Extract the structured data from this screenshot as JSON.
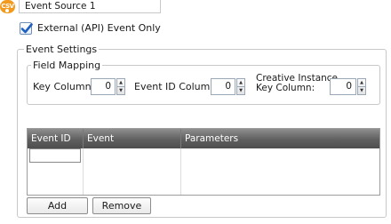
{
  "source": {
    "icon_text": "CSV",
    "name": "Event Source 1"
  },
  "external_only": {
    "label": "External (API) Event Only",
    "checked": true
  },
  "event_settings": {
    "legend": "Event Settings",
    "field_mapping": {
      "legend": "Field Mapping",
      "key_column": {
        "label": "Key Column:",
        "value": "0"
      },
      "event_id_column": {
        "label": "Event ID Column:",
        "value": "0"
      },
      "creative_instance_key_column": {
        "label_line1": "Creative Instance",
        "label_line2": "Key Column:",
        "value": "0"
      }
    },
    "grid": {
      "columns": [
        "Event ID",
        "Event",
        "Parameters"
      ]
    },
    "buttons": {
      "add": "Add",
      "remove": "Remove"
    }
  },
  "colors": {
    "accent": "#f29a1d",
    "check": "#1f5fbf",
    "grid_header": "#5f5f5f"
  }
}
